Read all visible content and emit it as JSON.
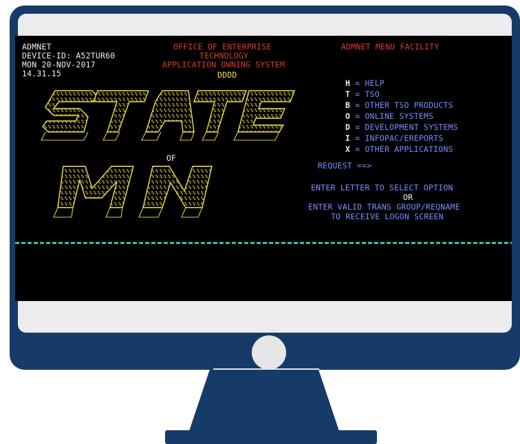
{
  "terminal": {
    "left_header": {
      "line1": "ADMNET",
      "line2": "DEVICE-ID: A52TUR60",
      "line3": "MON 20-NOV-2017",
      "line4": "14.31.15"
    },
    "center_header": {
      "line1": "OFFICE OF ENTERPRISE",
      "line2": "TECHNOLOGY",
      "line3": "APPLICATION OWNING SYSTEM",
      "line4": "DDDD"
    },
    "right_header": {
      "line1": "ADMNET MENU FACILITY"
    },
    "menu": [
      {
        "key": "H",
        "label": "HELP"
      },
      {
        "key": "T",
        "label": "TSO"
      },
      {
        "key": "B",
        "label": "OTHER TSO PRODUCTS"
      },
      {
        "key": "O",
        "label": "ONLINE SYSTEMS"
      },
      {
        "key": "D",
        "label": "DEVELOPMENT SYSTEMS"
      },
      {
        "key": "I",
        "label": "INFOPAC/EREPORTS"
      },
      {
        "key": "X",
        "label": "OTHER APPLICATIONS"
      }
    ],
    "request_label": "REQUEST ==>",
    "instruction1": "ENTER LETTER TO SELECT OPTION",
    "instruction2": "OR",
    "instruction3": "ENTER VALID TRANS GROUP/REQNAME",
    "instruction4": "TO RECEIVE LOGON SCREEN",
    "logo_of": "OF"
  }
}
